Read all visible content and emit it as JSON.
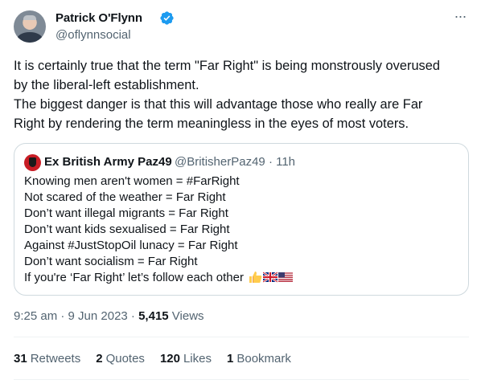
{
  "author": {
    "name": "Patrick O'Flynn",
    "handle": "@oflynnsocial"
  },
  "tweet": {
    "lines": [
      "It is certainly true that the term \"Far Right\" is being monstrously overused",
      "by the liberal-left establishment.",
      "The biggest danger is that this will advantage those who really are Far",
      "Right by rendering the term meaningless in the eyes of most voters."
    ]
  },
  "quote": {
    "name": "Ex British Army Paz49",
    "handle": "@BritisherPaz49 · 11h",
    "lines": [
      "Knowing men aren't women = #FarRight",
      "Not scared of the weather = Far Right",
      "Don’t want illegal migrants = Far Right",
      "Don’t want kids sexualised = Far Right",
      "Against #JustStopOil lunacy = Far Right",
      "Don’t want socialism = Far Right",
      "If you're ‘Far Right’ let’s follow each other"
    ]
  },
  "meta": {
    "time_date": "9:25 am · 9 Jun 2023 · ",
    "views_count": "5,415",
    "views_label": " Views"
  },
  "stats": {
    "retweets_count": "31",
    "retweets_label": "Retweets",
    "quotes_count": "2",
    "quotes_label": "Quotes",
    "likes_count": "120",
    "likes_label": "Likes",
    "bookmarks_count": "1",
    "bookmarks_label": "Bookmark"
  },
  "colors": {
    "verified": "#1d9bf0",
    "secondary_text": "#536471",
    "border": "#cfd9de"
  },
  "icons": [
    "verified-badge-icon",
    "more-icon",
    "thumbs-up-emoji",
    "uk-flag-emoji",
    "us-flag-emoji"
  ]
}
